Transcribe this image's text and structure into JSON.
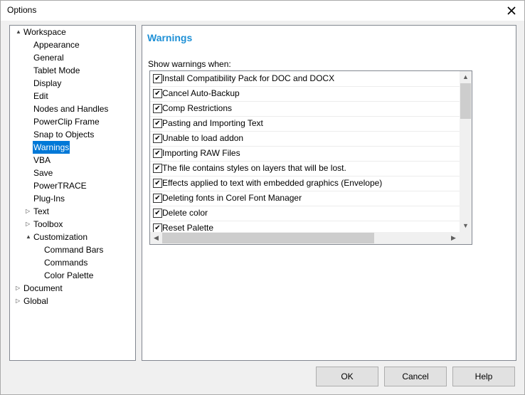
{
  "window": {
    "title": "Options"
  },
  "tree": [
    {
      "label": "Workspace",
      "exp": "▲"
    },
    {
      "label": "Appearance",
      "exp": ""
    },
    {
      "label": "General",
      "exp": ""
    },
    {
      "label": "Tablet Mode",
      "exp": ""
    },
    {
      "label": "Display",
      "exp": ""
    },
    {
      "label": "Edit",
      "exp": ""
    },
    {
      "label": "Nodes and Handles",
      "exp": ""
    },
    {
      "label": "PowerClip Frame",
      "exp": ""
    },
    {
      "label": "Snap to Objects",
      "exp": ""
    },
    {
      "label": "Warnings",
      "exp": "",
      "selected": true
    },
    {
      "label": "VBA",
      "exp": ""
    },
    {
      "label": "Save",
      "exp": ""
    },
    {
      "label": "PowerTRACE",
      "exp": ""
    },
    {
      "label": "Plug-Ins",
      "exp": ""
    },
    {
      "label": "Text",
      "exp": "▷"
    },
    {
      "label": "Toolbox",
      "exp": "▷"
    },
    {
      "label": "Customization",
      "exp": "▲"
    },
    {
      "label": "Command Bars",
      "exp": ""
    },
    {
      "label": "Commands",
      "exp": ""
    },
    {
      "label": "Color Palette",
      "exp": ""
    },
    {
      "label": "Document",
      "exp": "▷"
    },
    {
      "label": "Global",
      "exp": "▷"
    }
  ],
  "panel": {
    "title": "Warnings",
    "section_label": "Show warnings when:",
    "items": [
      {
        "label": "Install Compatibility Pack for DOC and DOCX",
        "checked": true
      },
      {
        "label": "Cancel Auto-Backup",
        "checked": true
      },
      {
        "label": "Comp Restrictions",
        "checked": true
      },
      {
        "label": "Pasting and Importing Text",
        "checked": true
      },
      {
        "label": "Unable to load addon",
        "checked": true
      },
      {
        "label": "Importing RAW Files",
        "checked": true
      },
      {
        "label": "The file contains styles on layers that will be lost.",
        "checked": true
      },
      {
        "label": "Effects applied to text with embedded graphics (Envelope)",
        "checked": true
      },
      {
        "label": "Deleting fonts in Corel Font Manager",
        "checked": true
      },
      {
        "label": "Delete color",
        "checked": true
      },
      {
        "label": "Reset Palette",
        "checked": true
      }
    ]
  },
  "buttons": {
    "ok": "OK",
    "cancel": "Cancel",
    "help": "Help"
  },
  "icons": {
    "check": "✔",
    "close": "✕",
    "up": "▲",
    "down": "▼",
    "left": "◀",
    "right": "▶"
  }
}
